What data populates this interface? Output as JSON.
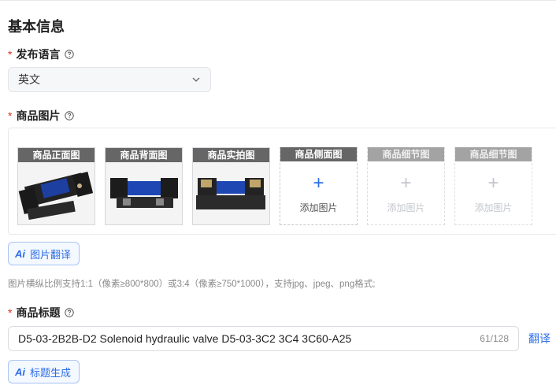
{
  "section": {
    "title": "基本信息"
  },
  "language_field": {
    "required_mark": "*",
    "label": "发布语言",
    "help_icon": "question-circle-icon",
    "selected_value": "英文",
    "dropdown_icon": "chevron-down-icon"
  },
  "images_field": {
    "required_mark": "*",
    "label": "商品图片",
    "help_icon": "question-circle-icon",
    "slots": [
      {
        "caption": "商品正面图",
        "state": "filled",
        "image": "hydraulic-valve-front-photo"
      },
      {
        "caption": "商品背面图",
        "state": "filled",
        "image": "hydraulic-valve-back-photo"
      },
      {
        "caption": "商品实拍图",
        "state": "filled",
        "image": "hydraulic-valve-real-photo"
      },
      {
        "caption": "商品侧面图",
        "state": "empty",
        "plus": "+",
        "add_label": "添加图片"
      },
      {
        "caption": "商品细节图",
        "state": "disabled",
        "plus": "+",
        "add_label": "添加图片"
      },
      {
        "caption": "商品细节图",
        "state": "disabled",
        "plus": "+",
        "add_label": "添加图片"
      }
    ],
    "translate_button": {
      "icon": "Ai",
      "label": "图片翻译"
    },
    "hint": "图片横纵比例支持1:1（像素≥800*800）或3:4（像素≥750*1000），支持jpg、jpeg、png格式;"
  },
  "title_field": {
    "required_mark": "*",
    "label": "商品标题",
    "help_icon": "question-circle-icon",
    "value": "D5-03-2B2B-D2 Solenoid hydraulic valve D5-03-3C2 3C4 3C60-A25",
    "char_count": "61/128",
    "translate_link": "翻译",
    "generate_button": {
      "icon": "Ai",
      "label": "标题生成"
    }
  },
  "colors": {
    "accent": "#2d6ee6",
    "required": "#e0301e",
    "caption_bg": "#666666"
  }
}
